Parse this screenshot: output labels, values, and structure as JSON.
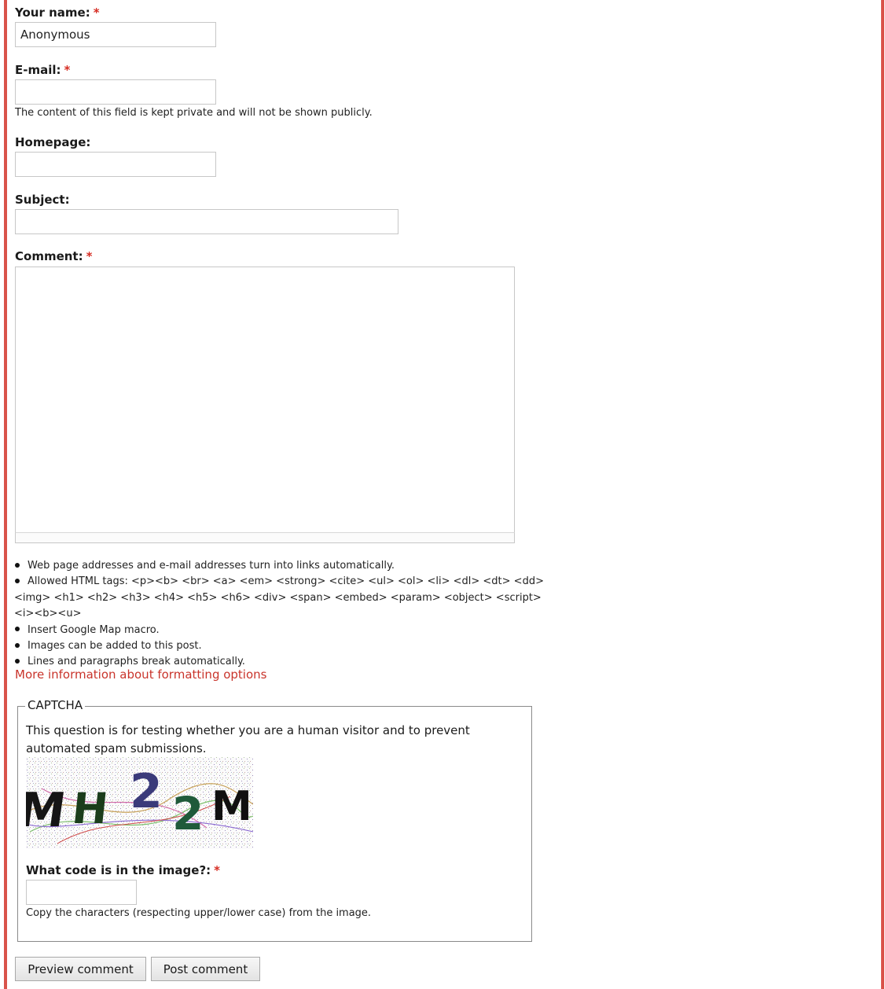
{
  "form": {
    "name": {
      "label": "Your name:",
      "required_mark": "*",
      "value": "Anonymous"
    },
    "email": {
      "label": "E-mail:",
      "required_mark": "*",
      "value": "",
      "description": "The content of this field is kept private and will not be shown publicly."
    },
    "homepage": {
      "label": "Homepage:",
      "value": ""
    },
    "subject": {
      "label": "Subject:",
      "value": ""
    },
    "comment": {
      "label": "Comment:",
      "required_mark": "*",
      "value": ""
    }
  },
  "formatting_tips": [
    "Web page addresses and e-mail addresses turn into links automatically.",
    "Allowed HTML tags: <p><b> <br> <a> <em> <strong> <cite> <ul> <ol> <li> <dl> <dt> <dd> <img> <h1> <h2> <h3> <h4> <h5> <h6> <div> <span> <embed> <param> <object> <script><i><b><u>",
    "Insert Google Map macro.",
    "Images can be added to this post.",
    "Lines and paragraphs break automatically."
  ],
  "more_info_link": "More information about formatting options",
  "captcha": {
    "legend": "CAPTCHA",
    "description": "This question is for testing whether you are a human visitor and to prevent automated spam submissions.",
    "image_code": "MH22M",
    "question_label": "What code is in the image?:",
    "required_mark": "*",
    "answer_value": "",
    "answer_description": "Copy the characters (respecting upper/lower case) from the image."
  },
  "buttons": {
    "preview": "Preview comment",
    "post": "Post comment"
  },
  "colors": {
    "accent_border": "#d9534a",
    "link": "#c9342b",
    "required": "#d62c22"
  }
}
